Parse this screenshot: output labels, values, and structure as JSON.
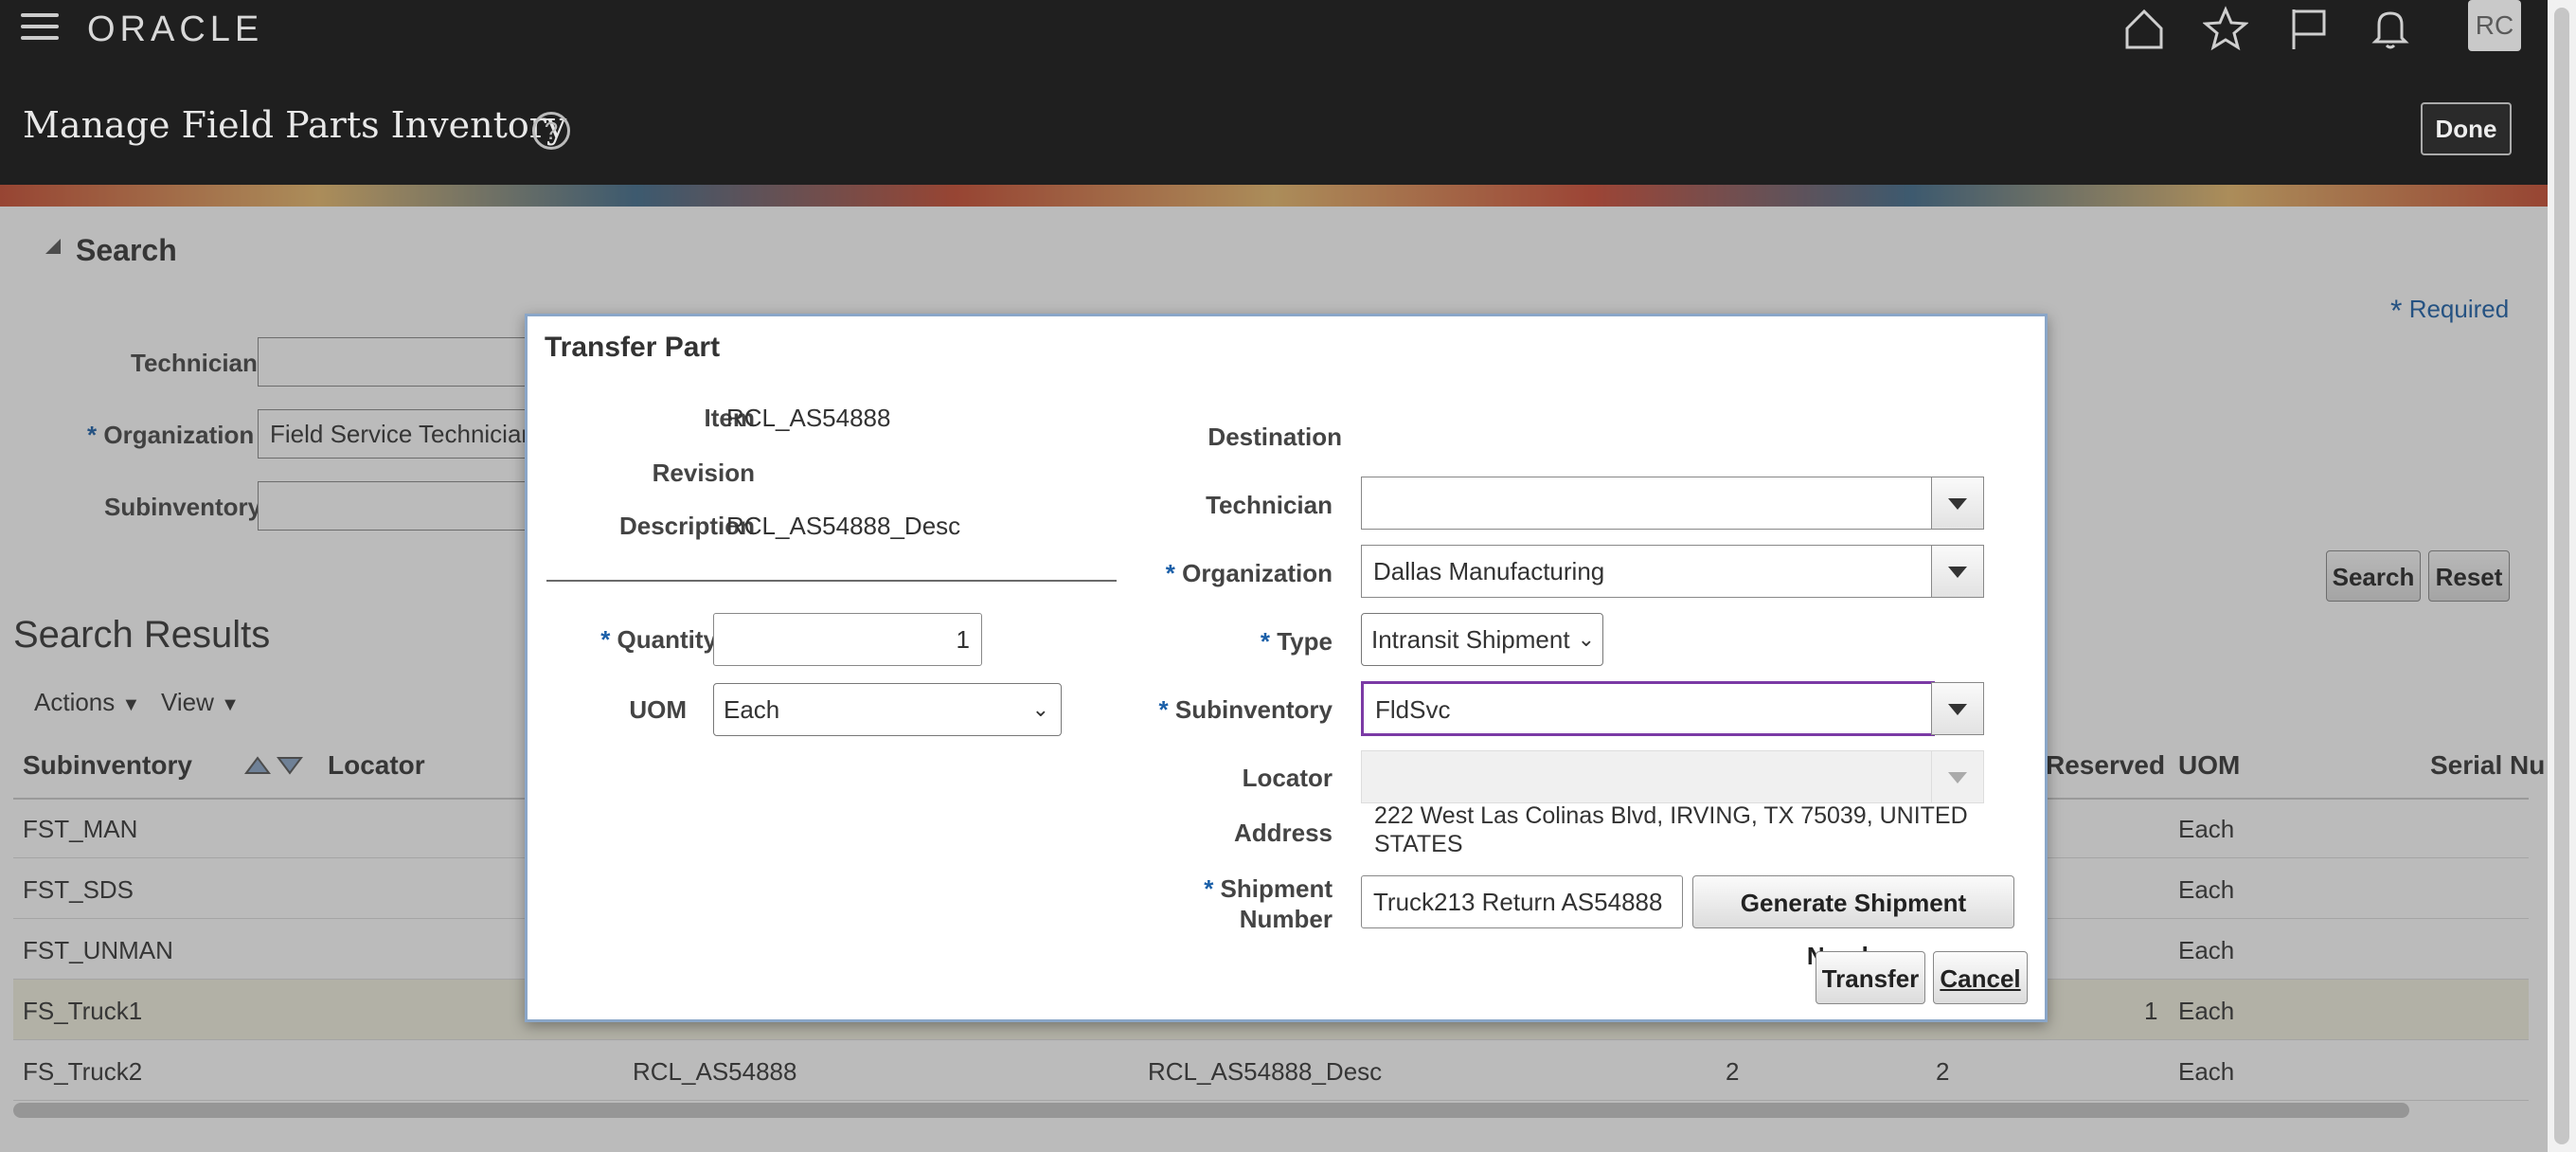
{
  "header": {
    "logo": "ORACLE",
    "avatar": "RC",
    "page_title": "Manage Field Parts Inventory",
    "help": "?",
    "done_label": "Done"
  },
  "search": {
    "title": "Search",
    "required_note": "Required",
    "technician_label": "Technician",
    "organization_label": "Organization",
    "organization_value": "Field Service Technicians",
    "subinventory_label": "Subinventory",
    "search_button": "Search",
    "reset_button": "Reset"
  },
  "results": {
    "title": "Search Results",
    "actions": "Actions",
    "view": "View",
    "headers": {
      "subinventory": "Subinventory",
      "locator": "Locator",
      "reserved": "Reserved",
      "uom": "UOM",
      "serial": "Serial Nu"
    },
    "rows": [
      {
        "subinventory": "FST_MAN",
        "uom": "Each"
      },
      {
        "subinventory": "FST_SDS",
        "uom": "Each"
      },
      {
        "subinventory": "FST_UNMAN",
        "uom": "Each"
      },
      {
        "subinventory": "FS_Truck1",
        "reserved": "1",
        "uom": "Each"
      },
      {
        "subinventory": "FS_Truck2",
        "item": "RCL_AS54888",
        "desc": "RCL_AS54888_Desc",
        "q1": "2",
        "q2": "2",
        "uom": "Each"
      }
    ]
  },
  "dialog": {
    "title": "Transfer Part",
    "item_label": "Item",
    "item_value": "RCL_AS54888",
    "revision_label": "Revision",
    "description_label": "Description",
    "description_value": "RCL_AS54888_Desc",
    "quantity_label": "Quantity",
    "quantity_value": "1",
    "uom_label": "UOM",
    "uom_value": "Each",
    "destination_label": "Destination",
    "technician_label": "Technician",
    "organization_label": "Organization",
    "organization_value": "Dallas Manufacturing",
    "type_label": "Type",
    "type_value": "Intransit Shipment",
    "subinventory_label": "Subinventory",
    "subinventory_value": "FldSvc",
    "locator_label": "Locator",
    "address_label": "Address",
    "address_line1": "222 West Las Colinas Blvd, IRVING, TX 75039, UNITED",
    "address_line2": "STATES",
    "shipment_label_1": "Shipment",
    "shipment_label_2": "Number",
    "shipment_value": "Truck213 Return AS54888",
    "generate_button": "Generate Shipment Number",
    "transfer_button": "Transfer",
    "cancel_button": "Cancel",
    "required_mark": "*"
  },
  "colors": {
    "header_bg": "#1f1f1f",
    "required": "#1a5fa8",
    "focus_border": "#7b3aa5",
    "selected_row": "#f2f0df"
  }
}
